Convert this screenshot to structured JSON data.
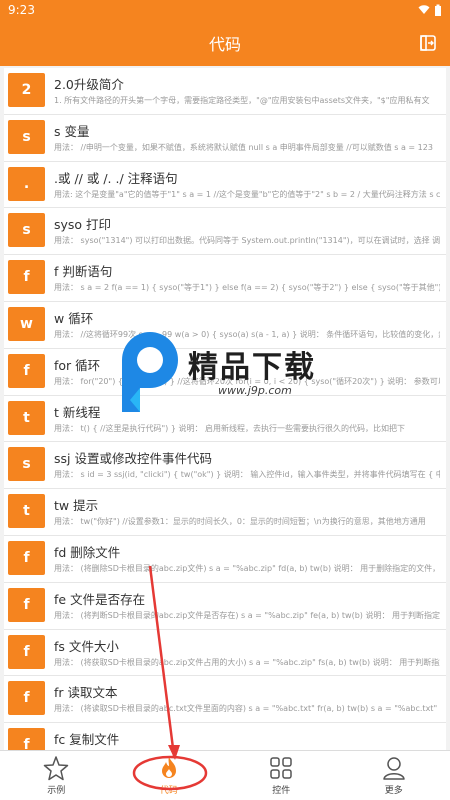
{
  "status": {
    "time": "9:23"
  },
  "appbar": {
    "title": "代码"
  },
  "items": [
    {
      "badge": "2",
      "name": "2.0升级简介",
      "desc": "1. 所有文件路径的开头第一个字母，需要指定路径类型，\"@\"应用安装包中assets文件夹，\"$\"应用私有文"
    },
    {
      "badge": "s",
      "name": "s 变量",
      "desc": "用法：  //申明一个变量，如果不赋值，系统将默认赋值 null s a 申明事件局部变量 //可以赋数值 s a = 123"
    },
    {
      "badge": ".",
      "name": ".或 // 或 /. ./ 注释语句",
      "desc": "用法: 这个是变量\"a\"它的值等于\"1\" s a = 1 //这个是变量\"b\"它的值等于\"2\" s b = 2 / 大量代码注释方法 s c"
    },
    {
      "badge": "s",
      "name": "syso 打印",
      "desc": "用法：  syso(\"1314\") 可以打印出数据。代码同等于 System.out.println(\"1314\")，可以在调试时，选择 调"
    },
    {
      "badge": "f",
      "name": "f 判断语句",
      "desc": "用法：  s a = 2 f(a == 1) {      syso(\"等于1\") } else f(a == 2) {      syso(\"等于2\") } else {    syso(\"等于其他\") } s a = 1"
    },
    {
      "badge": "w",
      "name": "w 循环",
      "desc": "用法：  //这将循环99次 s a = 99 w(a > 0) { syso(a) s(a - 1, a) }  说明：  条件循环语句，比较值的变化，然后"
    },
    {
      "badge": "f",
      "name": "for 循环",
      "desc": "用法：  for(\"20\") { syso(\"20\") } //这将循环20次  for(i = 0, i < 20) { syso(\"循环20次\") }  说明：  参数可以给"
    },
    {
      "badge": "t",
      "name": "t 新线程",
      "desc": "用法：  t() {   //这里是执行代码\") }  说明：  启用新线程，去执行一些需要执行很久的代码，比如把下"
    },
    {
      "badge": "s",
      "name": "ssj 设置或修改控件事件代码",
      "desc": "用法：  s id = 3 ssj(id, \"clicki\") { tw(\"ok\") }  说明：  输入控件id，输入事件类型，并将事件代码填写在 { 中}，"
    },
    {
      "badge": "t",
      "name": "tw 提示",
      "desc": "用法：  tw(\"你好\") //设置参数1：显示的时间长久，0：显示的时间短暂；\\n为换行的意思，其他地方通用"
    },
    {
      "badge": "f",
      "name": "fd 删除文件",
      "desc": "用法：  (将删除SD卡根目录的abc.zip文件) s a = \"%abc.zip\" fd(a, b) tw(b)  说明：  用于删除指定的文件，显"
    },
    {
      "badge": "f",
      "name": "fe 文件是否存在",
      "desc": "用法：  (将判断SD卡根目录的abc.zip文件是否存在) s a = \"%abc.zip\" fe(a, b) tw(b)  说明：  用于判断指定的文"
    },
    {
      "badge": "f",
      "name": "fs 文件大小",
      "desc": "用法：  (将获取SD卡根目录的abc.zip文件占用的大小) s a = \"%abc.zip\" fs(a, b) tw(b)  说明：  用于判断指定的"
    },
    {
      "badge": "f",
      "name": "fr 读取文本",
      "desc": "用法：  (将读取SD卡根目录的abc.txt文件里面的内容) s a = \"%abc.txt\" fr(a, b) tw(b)  s a = \"%abc.txt\" s b = \"utf-"
    },
    {
      "badge": "f",
      "name": "fc 复制文件",
      "desc": "用法：  (将SD卡根目录的abc.zip文件复制到目录中去) s a = \"%abc.zip\" s b = \"%abc2.zip\""
    }
  ],
  "watermark": {
    "text": "精品下载",
    "url": "www.j9p.com"
  },
  "tabs": [
    {
      "label": "示例",
      "icon": "star-icon",
      "active": false
    },
    {
      "label": "代码",
      "icon": "flame-icon",
      "active": true
    },
    {
      "label": "控件",
      "icon": "grid-icon",
      "active": false
    },
    {
      "label": "更多",
      "icon": "person-icon",
      "active": false
    }
  ],
  "colors": {
    "accent": "#f5841f",
    "annotation": "#e53935"
  }
}
